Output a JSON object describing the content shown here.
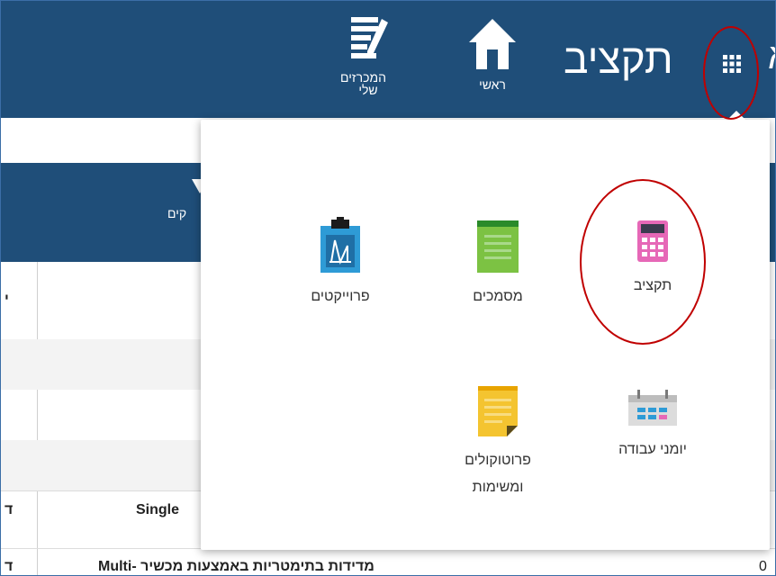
{
  "app": {
    "title": "תקציב"
  },
  "nav": {
    "home_label": "ראשי",
    "tenders_label": "המכרזים שלי"
  },
  "strip": {
    "partial_label": "קים"
  },
  "table": {
    "rows": [
      {
        "left": "ד",
        "text": "Single",
        "right": ""
      },
      {
        "left": "ד",
        "text": "מדידות בתימטריות באמצעות מכשיר -Multi",
        "right": "0"
      }
    ],
    "header_left": "י"
  },
  "launcher_menu": {
    "items": [
      {
        "label": "תקציב",
        "icon": "calculator-icon"
      },
      {
        "label": "מסמכים",
        "icon": "document-icon"
      },
      {
        "label": "פרוייקטים",
        "icon": "project-clipboard-icon"
      },
      {
        "label": "יומני עבודה",
        "icon": "calendar-icon"
      },
      {
        "label": "פרוטוקולים ומשימות",
        "icon": "notes-icon"
      }
    ]
  },
  "colors": {
    "header_bg": "#1f4e79",
    "annotation": "#c00000",
    "calculator": "#e668b7",
    "documents": "#7cc243",
    "projects": "#2e9bd6",
    "notes": "#f4c430"
  }
}
